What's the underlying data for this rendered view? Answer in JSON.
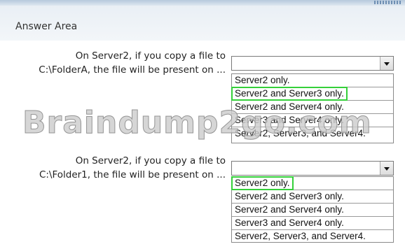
{
  "header": {
    "title": "Answer Area"
  },
  "questions": [
    {
      "line1": "On Server2, if you copy a file to",
      "line2": "C:\\FolderA, the file will be present on ...",
      "options": [
        "Server2 only.",
        "Server2 and Server3 only.",
        "Server2 and Server4 only.",
        "Server3 and Server4 only.",
        "Server2, Server3, and Server4."
      ],
      "selected_option": "Server2 and Server3 only."
    },
    {
      "line1": "On Server2, if you copy a file to",
      "line2": "C:\\Folder1, the file will be present on ...",
      "options": [
        "Server2 only.",
        "Server2 and Server3 only.",
        "Server2 and Server4 only.",
        "Server3 and Server4 only.",
        "Server2, Server3, and Server4."
      ],
      "selected_option": "Server2 only."
    }
  ],
  "watermark": {
    "text": "Braindump2go.com"
  },
  "colors": {
    "selection_highlight": "#35d03a",
    "header_band": "#e9eff5"
  }
}
